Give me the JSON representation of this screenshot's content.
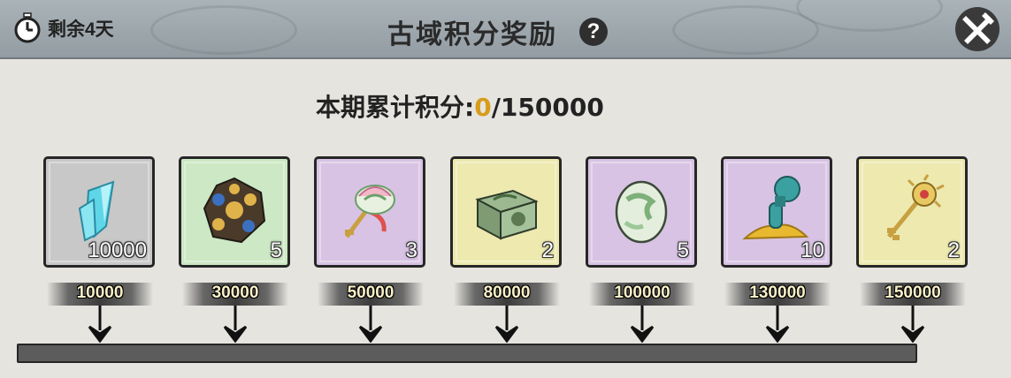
{
  "header": {
    "remaining": "剩余4天",
    "title": "古域积分奖励",
    "help": "?"
  },
  "points": {
    "label": "本期累计积分:",
    "current": "0",
    "separator": "/",
    "max": "150000",
    "progress_fraction": 0
  },
  "rewards": [
    {
      "item": "blue-crystal-icon",
      "count": "10000",
      "milestone": "10000",
      "bg": "gray"
    },
    {
      "item": "hexagon-orb-icon",
      "count": "5",
      "milestone": "30000",
      "bg": "green"
    },
    {
      "item": "lotus-key-icon",
      "count": "3",
      "milestone": "50000",
      "bg": "purple"
    },
    {
      "item": "jade-chest-icon",
      "count": "2",
      "milestone": "80000",
      "bg": "yellow"
    },
    {
      "item": "jade-egg-icon",
      "count": "5",
      "milestone": "100000",
      "bg": "purple"
    },
    {
      "item": "gourd-sand-icon",
      "count": "10",
      "milestone": "130000",
      "bg": "purple"
    },
    {
      "item": "golden-key-icon",
      "count": "2",
      "milestone": "150000",
      "bg": "yellow"
    }
  ],
  "colors": {
    "accent": "#d79c1b",
    "gray": "#c8c8c8",
    "green": "#cde8c4",
    "purple": "#d8c3e4",
    "yellow": "#ede9af"
  }
}
